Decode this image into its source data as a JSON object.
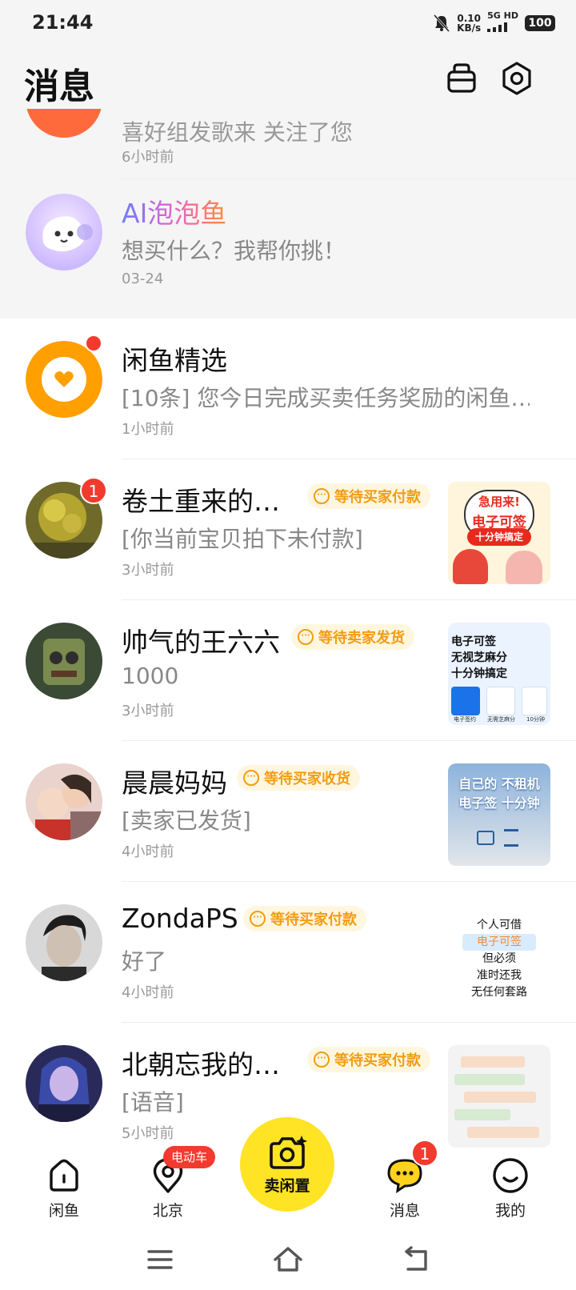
{
  "status_bar": {
    "time": "21:44",
    "speed_value": "0.10",
    "speed_unit": "KB/s",
    "network": "5G HD",
    "battery": "100"
  },
  "header": {
    "title": "消息"
  },
  "top_partial_row": {
    "preview": "喜好组发歌来 关注了您",
    "time": "6小时前"
  },
  "ai_row": {
    "name": "AI泡泡鱼",
    "preview": "想买什么？我帮你挑！",
    "time": "03-24"
  },
  "messages": [
    {
      "name": "闲鱼精选",
      "preview": "[10条] 您今日完成买卖任务奖励的闲鱼…",
      "time": "1小时前",
      "red_dot": true
    },
    {
      "name": "卷土重来的…",
      "status": "等待买家付款",
      "preview": "[你当前宝贝拍下未付款]",
      "time": "3小时前",
      "unread": "1",
      "thumb": {
        "l1": "急用来!",
        "l2": "电子可签",
        "l3": "十分钟搞定"
      }
    },
    {
      "name": "帅气的王六六",
      "status": "等待卖家发货",
      "preview": "1000",
      "time": "3小时前",
      "thumb": {
        "l1": "电子可签",
        "l2": "无视芝麻分",
        "l3": "十分钟搞定",
        "c1": "电子签约",
        "c2": "无需芝麻分",
        "c3": "10分钟"
      }
    },
    {
      "name": "晨晨妈妈",
      "status": "等待买家收货",
      "preview": "[卖家已发货]",
      "time": "4小时前",
      "thumb": {
        "l1": "自己的 不租机",
        "l2": "电子签 十分钟"
      }
    },
    {
      "name": "ZondaPS",
      "status": "等待买家付款",
      "preview": "好了",
      "time": "4小时前",
      "thumb": {
        "l1": "个人可借",
        "l2": "电子可签",
        "l3": "但必须",
        "l4": "准时还我",
        "l5": "无任何套路"
      }
    },
    {
      "name": "北朝忘我的…",
      "status": "等待买家付款",
      "preview": "[语音]",
      "time": "5小时前"
    }
  ],
  "tabbar": {
    "home": "闲鱼",
    "city": "北京",
    "city_badge": "电动车",
    "sell": "卖闲置",
    "messages": "消息",
    "messages_badge": "1",
    "mine": "我的"
  },
  "colors": {
    "accent": "#ffe325",
    "tag_text": "#f29d12",
    "badge": "#f33a2e"
  }
}
